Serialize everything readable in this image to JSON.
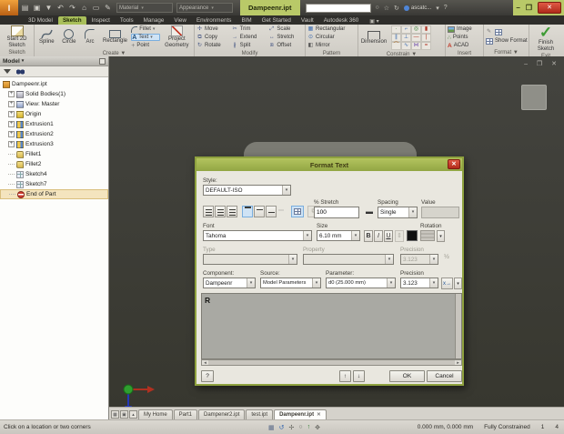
{
  "icons": {
    "dropdown": "▾",
    "up": "▴",
    "left": "◂",
    "right": "▸",
    "plus": "+",
    "minimize": "–",
    "restore": "❐",
    "close": "✕",
    "doc_controls": "– ❐ ✕"
  },
  "titlebar": {
    "title": "Dampeenr.ipt",
    "material_combo": "Material",
    "appearance_combo": "Appearance",
    "signin": "ascatc..."
  },
  "ribbon": {
    "tabs": [
      {
        "label": "3D Model"
      },
      {
        "label": "Sketch"
      },
      {
        "label": "Inspect"
      },
      {
        "label": "Tools"
      },
      {
        "label": "Manage"
      },
      {
        "label": "View"
      },
      {
        "label": "Environments"
      },
      {
        "label": "BIM"
      },
      {
        "label": "Get Started"
      },
      {
        "label": "Vault"
      },
      {
        "label": "Autodesk 360"
      }
    ],
    "sketch_panel": {
      "label": "Sketch",
      "start_2d_sketch": "Start 2D Sketch"
    },
    "create_panel": {
      "label": "Create ▼",
      "spline": "Spline",
      "circle": "Circle",
      "arc": "Arc",
      "rectangle": "Rectangle",
      "fillet": "Fillet",
      "text": "Text",
      "point": "Point",
      "project_geometry": "Project Geometry"
    },
    "modify_panel": {
      "label": "Modify",
      "move": "Move",
      "copy": "Copy",
      "rotate": "Rotate",
      "trim": "Trim",
      "extend": "Extend",
      "split": "Split",
      "scale": "Scale",
      "stretch": "Stretch",
      "offset": "Offset"
    },
    "pattern_panel": {
      "label": "Pattern",
      "rectangular": "Rectangular",
      "circular": "Circular",
      "mirror": "Mirror"
    },
    "constrain_panel": {
      "label": "Constrain ▼",
      "dimension": "Dimension"
    },
    "insert_panel": {
      "label": "Insert",
      "image": "Image",
      "points": "Points",
      "acad": "ACAD"
    },
    "format_panel": {
      "label": "Format ▼",
      "show_format": "Show Format"
    },
    "exit_panel": {
      "label": "Exit",
      "finish_sketch": "Finish Sketch"
    }
  },
  "browser": {
    "header": "Model",
    "items": [
      {
        "label": "Dampeenr.ipt"
      },
      {
        "label": "Solid Bodies(1)"
      },
      {
        "label": "View: Master"
      },
      {
        "label": "Origin"
      },
      {
        "label": "Extrusion1"
      },
      {
        "label": "Extrusion2"
      },
      {
        "label": "Extrusion3"
      },
      {
        "label": "Fillet1"
      },
      {
        "label": "Fillet2"
      },
      {
        "label": "Sketch4"
      },
      {
        "label": "Sketch7"
      },
      {
        "label": "End of Part"
      }
    ]
  },
  "dialog": {
    "title": "Format Text",
    "style_label": "Style:",
    "style_value": "DEFAULT-ISO",
    "stretch_label": "% Stretch",
    "stretch_value": "100",
    "spacing_label": "Spacing",
    "spacing_value": "Single",
    "value_label": "Value",
    "font_label": "Font",
    "font_value": "Tahoma",
    "size_label": "Size",
    "size_value": "6.10 mm",
    "bold": "B",
    "italic": "I",
    "underline": "U",
    "rotation_label": "Rotation",
    "type_label": "Type",
    "property_label": "Property",
    "precision_label": "Precision",
    "precision_disabled_value": "3.123",
    "component_label": "Component:",
    "component_value": "Dampeenr",
    "source_label": "Source:",
    "source_value": "Model Parameters",
    "parameter_label": "Parameter:",
    "parameter_value": "d0 (25.000 mm)",
    "precision2_label": "Precision",
    "precision2_value": "3.123",
    "insert_param": "x",
    "text_content": "R",
    "help_button": "?",
    "up_button": "↑",
    "down_button": "↓",
    "ok_button": "OK",
    "cancel_button": "Cancel"
  },
  "doc_tabs": [
    {
      "label": "My Home"
    },
    {
      "label": "Part1"
    },
    {
      "label": "Dampener2.ipt"
    },
    {
      "label": "test.ipt"
    },
    {
      "label": "Dampeenr.ipt"
    }
  ],
  "statusbar": {
    "prompt": "Click on a location or two corners",
    "coords": "0.000 mm, 0.000 mm",
    "constraint_status": "Fully Constrained",
    "count1": "1",
    "count2": "4"
  }
}
